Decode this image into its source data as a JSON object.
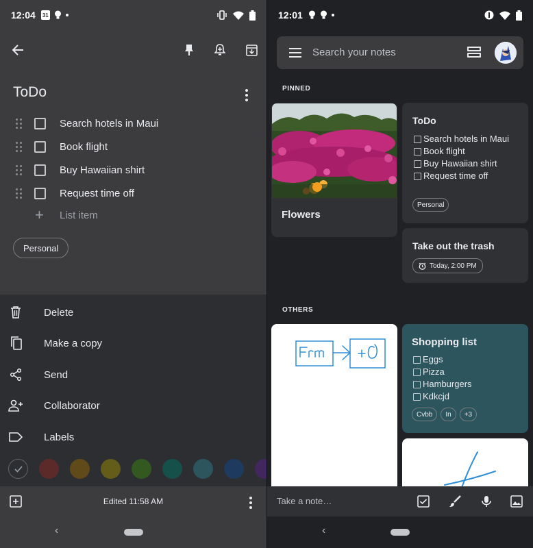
{
  "left": {
    "status": {
      "time": "12:04",
      "calendar_day": "31"
    },
    "note": {
      "title": "ToDo",
      "items": [
        {
          "text": "Search hotels in Maui",
          "checked": false
        },
        {
          "text": "Book flight",
          "checked": false
        },
        {
          "text": "Buy Hawaiian shirt",
          "checked": false
        },
        {
          "text": "Request time off",
          "checked": false
        }
      ],
      "add_item_placeholder": "List item",
      "label_chip": "Personal"
    },
    "menu": [
      {
        "label": "Delete",
        "icon": "trash-icon"
      },
      {
        "label": "Make a copy",
        "icon": "copy-icon"
      },
      {
        "label": "Send",
        "icon": "share-icon"
      },
      {
        "label": "Collaborator",
        "icon": "person-add-icon"
      },
      {
        "label": "Labels",
        "icon": "label-icon"
      }
    ],
    "colors": [
      "#5c2b29",
      "#614a19",
      "#635d19",
      "#345920",
      "#16504b",
      "#2d555e",
      "#1e3a5f",
      "#42275e"
    ],
    "edited": "Edited 11:58 AM"
  },
  "right": {
    "status": {
      "time": "12:01"
    },
    "search_placeholder": "Search your notes",
    "pinned_label": "PINNED",
    "others_label": "OTHERS",
    "cards": {
      "flowers": {
        "title": "Flowers"
      },
      "todo": {
        "title": "ToDo",
        "items": [
          "Search hotels in Maui",
          "Book flight",
          "Buy Hawaiian shirt",
          "Request time off"
        ],
        "label": "Personal"
      },
      "trash": {
        "title": "Take out the trash",
        "reminder": "Today, 2:00 PM"
      },
      "shopping": {
        "title": "Shopping list",
        "items": [
          "Eggs",
          "Pizza",
          "Hamburgers",
          "Kdkcjd"
        ],
        "labels": [
          "Cvbb",
          "In",
          "+3"
        ],
        "color": "#2d555e"
      },
      "drawing": {
        "text": "Frm → +∂"
      }
    },
    "take_note": "Take a note…"
  }
}
